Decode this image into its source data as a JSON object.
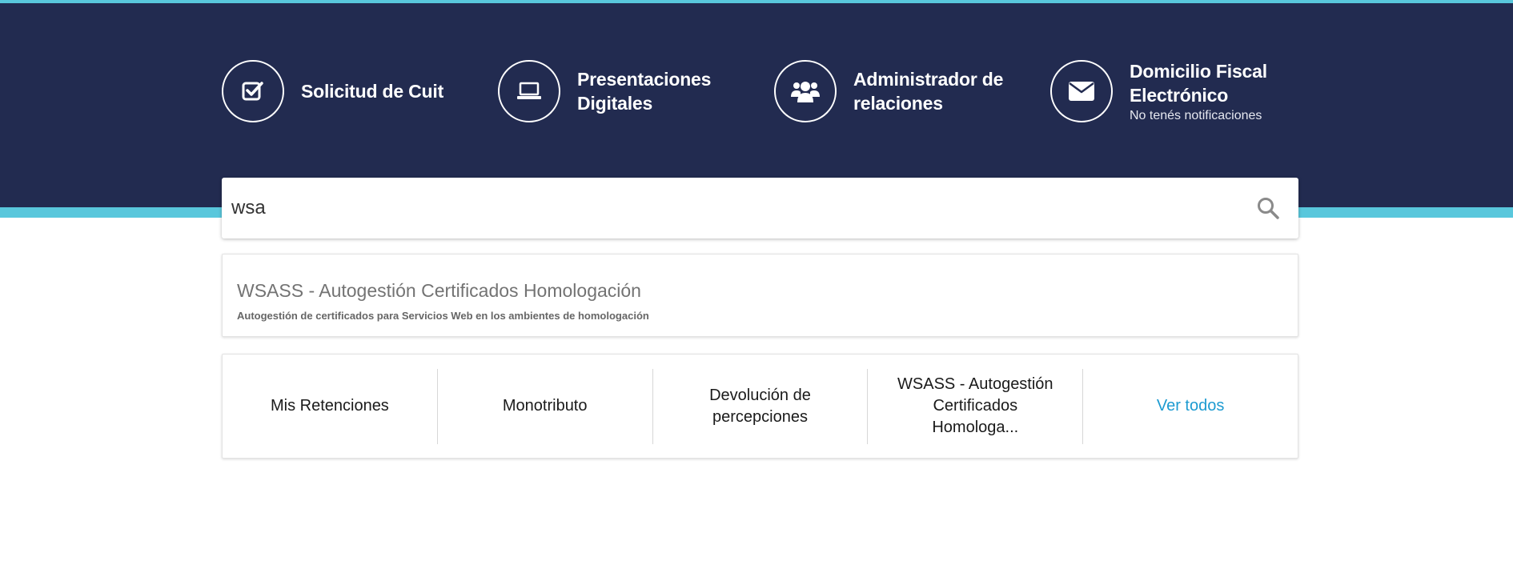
{
  "colors": {
    "hero_background": "#222b50",
    "accent_stripe": "#59c7dc",
    "link": "#1d9bd1"
  },
  "shortcuts": [
    {
      "icon": "checkbox-icon",
      "line1": "Solicitud de Cuit",
      "line2": "",
      "sub": ""
    },
    {
      "icon": "laptop-icon",
      "line1": "Presentaciones",
      "line2": "Digitales",
      "sub": ""
    },
    {
      "icon": "users-icon",
      "line1": "Administrador de",
      "line2": "relaciones",
      "sub": ""
    },
    {
      "icon": "envelope-icon",
      "line1": "Domicilio Fiscal",
      "line2": "Electrónico",
      "sub": "No tenés notificaciones"
    }
  ],
  "search": {
    "value": "wsa",
    "icon": "search-icon"
  },
  "result": {
    "title": "WSASS - Autogestión Certificados Homologación",
    "description": "Autogestión de certificados para Servicios Web en los ambientes de homologación"
  },
  "quick_links": {
    "items": [
      {
        "line1": "Mis Retenciones",
        "line2": "",
        "line3": ""
      },
      {
        "line1": "Monotributo",
        "line2": "",
        "line3": ""
      },
      {
        "line1": "Devolución de",
        "line2": "percepciones",
        "line3": ""
      },
      {
        "line1": "WSASS - Autogestión",
        "line2": "Certificados",
        "line3": "Homologa..."
      }
    ],
    "see_all": "Ver todos"
  }
}
